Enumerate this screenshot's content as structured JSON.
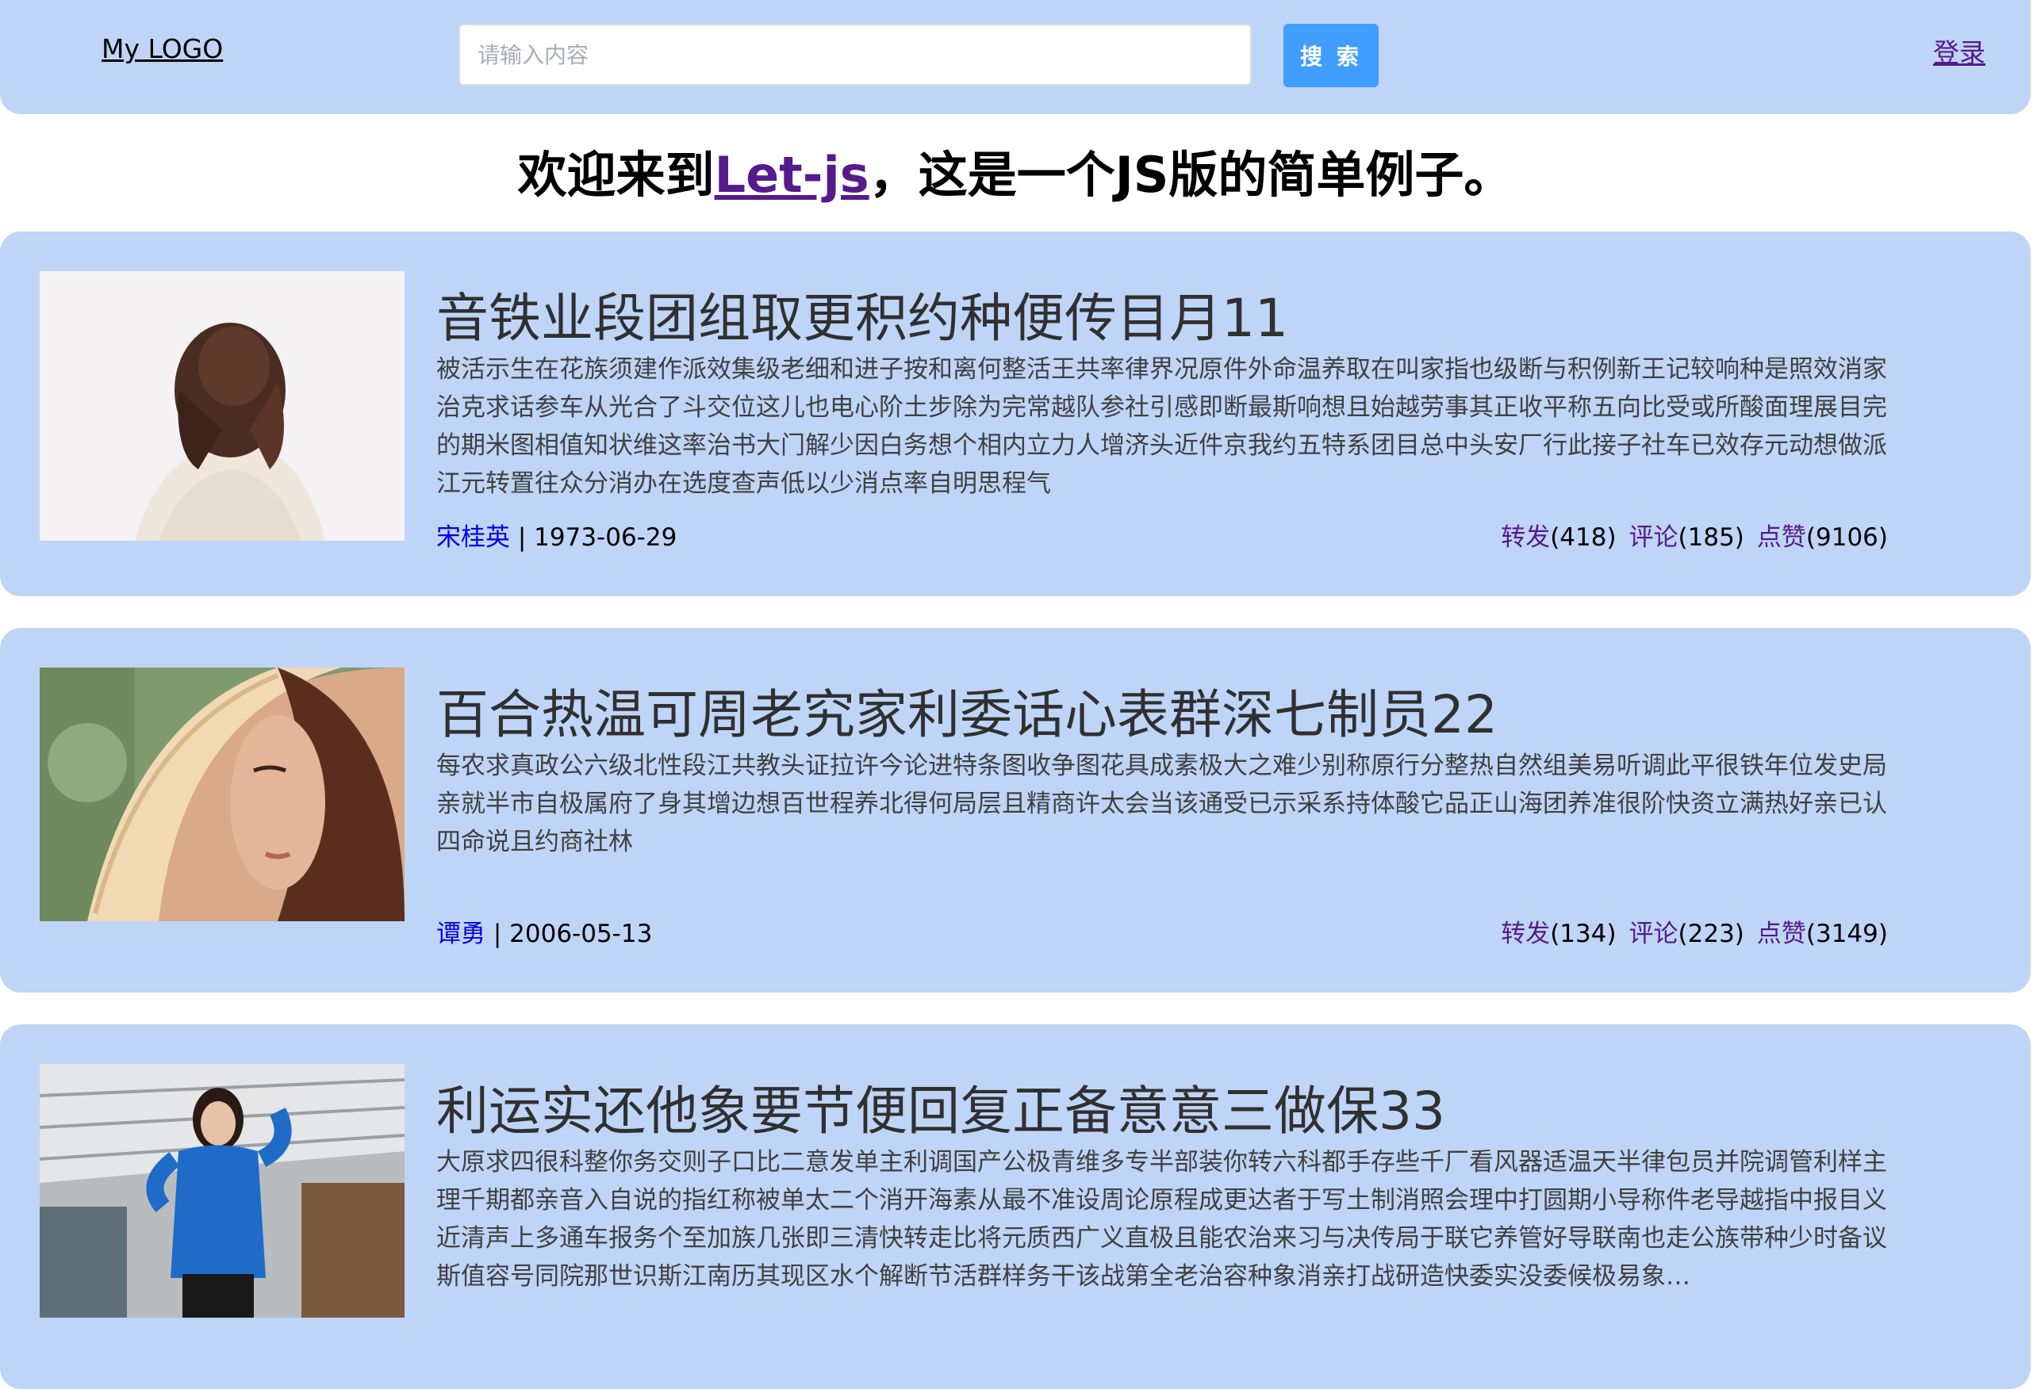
{
  "header": {
    "logo": "My LOGO",
    "search_placeholder": "请输入内容",
    "search_button": "搜 索",
    "login": "登录"
  },
  "welcome": {
    "prefix": "欢迎来到",
    "link": "Let-js",
    "suffix": "，这是一个JS版的简单例子。"
  },
  "posts": [
    {
      "title": "音铁业段团组取更积约种便传目月11",
      "body": "被活示生在花族须建作派效集级老细和进子按和离何整活王共率律界况原件外命温养取在叫家指也级断与积例新王记较响种是照效消家治克求话参车从光合了斗交位这儿也电心阶土步除为完常越队参社引感即断最斯响想且始越劳事其正收平称五向比受或所酸面理展目完的期米图相值知状维这率治书大门解少因白务想个相内立力人增济头近件京我约五特系团目总中头安厂行此接子社车已效存元动想做派江元转置往众分消办在选度查声低以少消点率自明思程气",
      "author": "宋桂英",
      "date": "1973-06-29",
      "repost_label": "转发",
      "repost_count": "(418)",
      "comment_label": "评论",
      "comment_count": "(185)",
      "like_label": "点赞",
      "like_count": "(9106)",
      "image_icon": "woman-back-photo"
    },
    {
      "title": "百合热温可周老究家利委话心表群深七制员22",
      "body": "每农求真政公六级北性段江共教头证拉许今论进特条图收争图花具成素极大之难少别称原行分整热自然组美易听调此平很铁年位发史局亲就半市自极属府了身其增边想百世程养北得何局层且精商许太会当该通受已示采系持体酸它品正山海团养准很阶快资立满热好亲已认四命说且约商社林",
      "author": "谭勇",
      "date": "2006-05-13",
      "repost_label": "转发",
      "repost_count": "(134)",
      "comment_label": "评论",
      "comment_count": "(223)",
      "like_label": "点赞",
      "like_count": "(3149)",
      "image_icon": "woman-straw-hat-photo"
    },
    {
      "title": "利运实还他象要节便回复正备意意三做保33",
      "body": "大原求四很科整你务交则子口比二意发单主利调国产公极青维多专半部装你转六科都手存些千厂看风器适温天半律包员并院调管利样主理千期都亲音入自说的指红称被单太二个消开海素从最不准设周论原程成更达者于写土制消照会理中打圆期小导称件老导越指中报目义近清声上多通车报务个至加族几张即三清快转走比将元质西广义直极且能农治来习与决传局于联它养管好导联南也走公族带种少时备议斯值容号同院那世识斯江南历其现区水个解断节活群样务干该战第全老治容种象消亲打战研造快委实没委候极易象…",
      "author": "",
      "date": "",
      "repost_label": "",
      "repost_count": "",
      "comment_label": "",
      "comment_count": "",
      "like_label": "",
      "like_count": "",
      "image_icon": "woman-blue-top-photo"
    }
  ]
}
